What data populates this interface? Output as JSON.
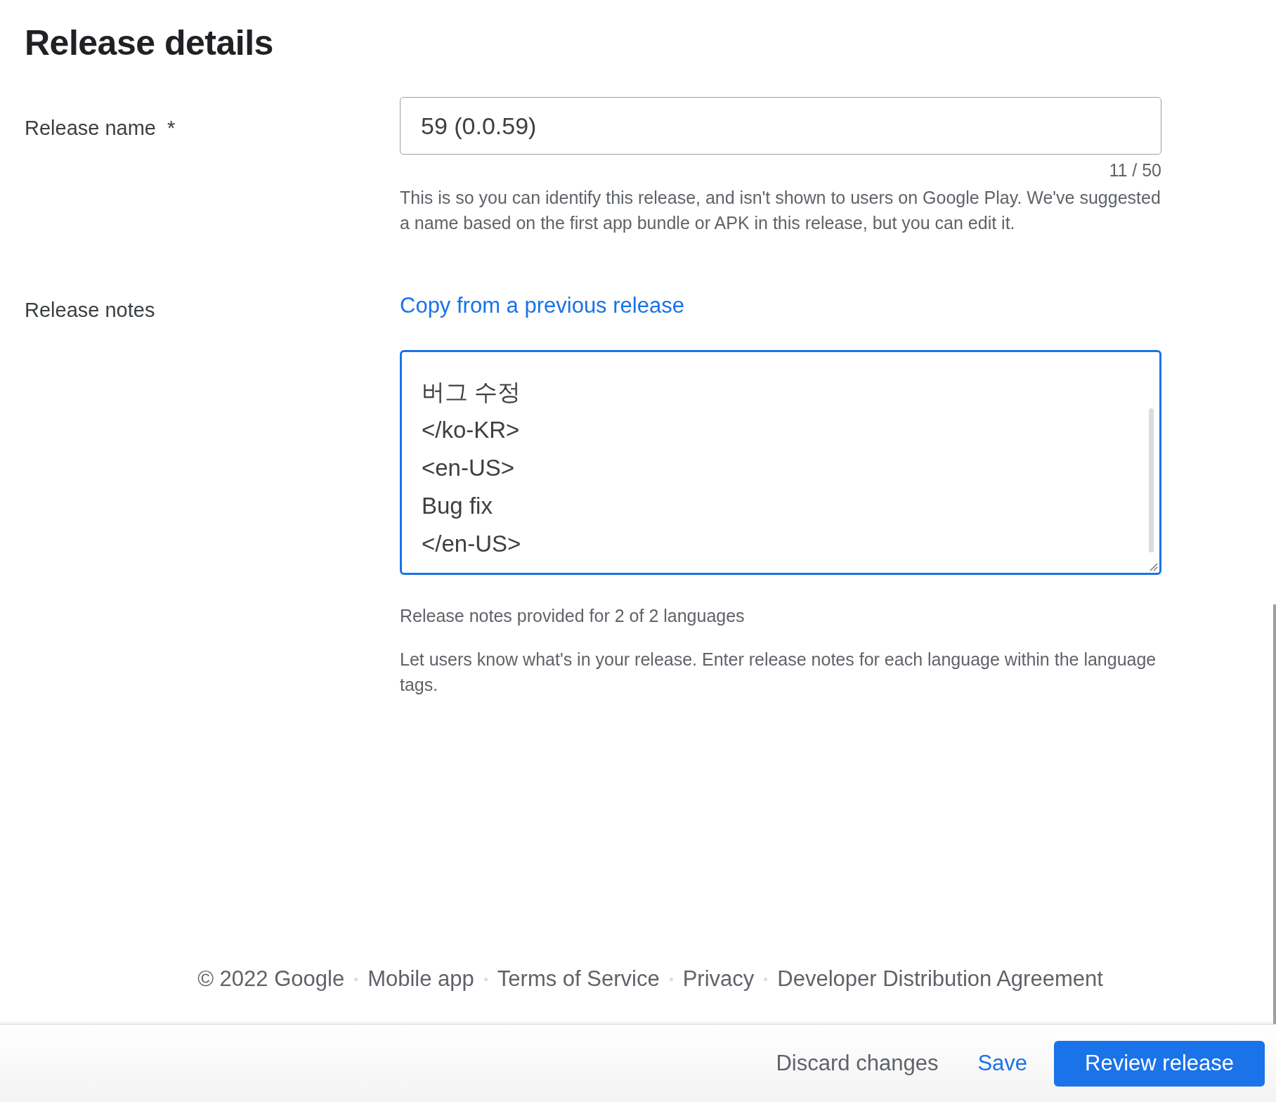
{
  "title": "Release details",
  "release_name": {
    "label": "Release name",
    "required_mark": "*",
    "value": "59 (0.0.59)",
    "counter": "11 / 50",
    "help": "This is so you can identify this release, and isn't shown to users on Google Play. We've suggested a name based on the first app bundle or APK in this release, but you can edit it."
  },
  "release_notes": {
    "label": "Release notes",
    "copy_link": "Copy from a previous release",
    "value": "버그 수정\n</ko-KR>\n<en-US>\nBug fix\n</en-US>",
    "focused": true,
    "status": "Release notes provided for 2 of 2 languages",
    "help": "Let users know what's in your release. Enter release notes for each language within the language tags."
  },
  "footer": {
    "copyright": "© 2022 Google",
    "links": [
      "Mobile app",
      "Terms of Service",
      "Privacy",
      "Developer Distribution Agreement"
    ]
  },
  "actions": [
    {
      "label": "Discard changes",
      "kind": "text"
    },
    {
      "label": "Save",
      "kind": "link"
    },
    {
      "label": "Review release",
      "kind": "primary"
    }
  ]
}
